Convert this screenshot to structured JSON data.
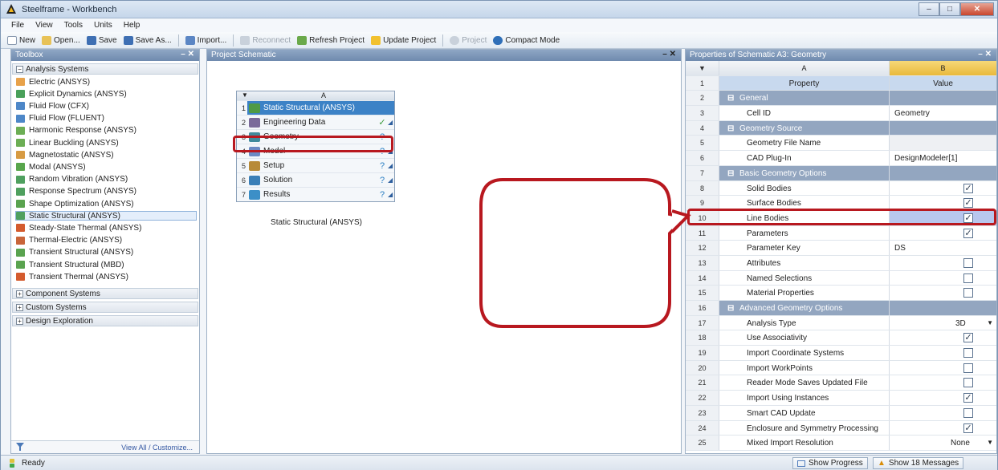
{
  "window": {
    "title": "Steelframe - Workbench"
  },
  "menu": [
    "File",
    "View",
    "Tools",
    "Units",
    "Help"
  ],
  "toolbar": {
    "new": "New",
    "open": "Open...",
    "save": "Save",
    "save_as": "Save As...",
    "import": "Import...",
    "reconnect": "Reconnect",
    "refresh": "Refresh Project",
    "update": "Update Project",
    "project": "Project",
    "compact": "Compact Mode"
  },
  "toolbox": {
    "title": "Toolbox",
    "analysis_header": "Analysis Systems",
    "items": [
      "Electric (ANSYS)",
      "Explicit Dynamics (ANSYS)",
      "Fluid Flow (CFX)",
      "Fluid Flow (FLUENT)",
      "Harmonic Response (ANSYS)",
      "Linear Buckling (ANSYS)",
      "Magnetostatic (ANSYS)",
      "Modal (ANSYS)",
      "Random Vibration (ANSYS)",
      "Response Spectrum (ANSYS)",
      "Shape Optimization (ANSYS)",
      "Static Structural (ANSYS)",
      "Steady-State Thermal (ANSYS)",
      "Thermal-Electric (ANSYS)",
      "Transient Structural (ANSYS)",
      "Transient Structural (MBD)",
      "Transient Thermal (ANSYS)"
    ],
    "component_header": "Component Systems",
    "custom_header": "Custom Systems",
    "design_header": "Design Exploration",
    "footer_link": "View All / Customize..."
  },
  "schematic": {
    "title": "Project Schematic",
    "column": "A",
    "rows": [
      {
        "n": "1",
        "label": "Static Structural (ANSYS)",
        "status": ""
      },
      {
        "n": "2",
        "label": "Engineering Data",
        "status": "✓"
      },
      {
        "n": "3",
        "label": "Geometry",
        "status": "?"
      },
      {
        "n": "4",
        "label": "Model",
        "status": "?"
      },
      {
        "n": "5",
        "label": "Setup",
        "status": "?"
      },
      {
        "n": "6",
        "label": "Solution",
        "status": "?"
      },
      {
        "n": "7",
        "label": "Results",
        "status": "?"
      }
    ],
    "caption": "Static Structural (ANSYS)"
  },
  "properties": {
    "title": "Properties of Schematic A3: Geometry",
    "col_a": "A",
    "col_b": "B",
    "rows": [
      {
        "n": "1",
        "a": "Property",
        "b": "Value",
        "type": "colh"
      },
      {
        "n": "2",
        "a": "General",
        "b": "",
        "type": "group"
      },
      {
        "n": "3",
        "a": "Cell ID",
        "b": "Geometry",
        "type": "text"
      },
      {
        "n": "4",
        "a": "Geometry Source",
        "b": "",
        "type": "group"
      },
      {
        "n": "5",
        "a": "Geometry File Name",
        "b": "",
        "type": "grey"
      },
      {
        "n": "6",
        "a": "CAD Plug-In",
        "b": "DesignModeler[1]",
        "type": "text"
      },
      {
        "n": "7",
        "a": "Basic Geometry Options",
        "b": "",
        "type": "group"
      },
      {
        "n": "8",
        "a": "Solid Bodies",
        "b": "checked",
        "type": "check"
      },
      {
        "n": "9",
        "a": "Surface Bodies",
        "b": "checked",
        "type": "check"
      },
      {
        "n": "10",
        "a": "Line Bodies",
        "b": "checked",
        "type": "check"
      },
      {
        "n": "11",
        "a": "Parameters",
        "b": "checked",
        "type": "check"
      },
      {
        "n": "12",
        "a": "Parameter Key",
        "b": "DS",
        "type": "text"
      },
      {
        "n": "13",
        "a": "Attributes",
        "b": "unchecked",
        "type": "check"
      },
      {
        "n": "14",
        "a": "Named Selections",
        "b": "unchecked",
        "type": "check"
      },
      {
        "n": "15",
        "a": "Material Properties",
        "b": "unchecked",
        "type": "check"
      },
      {
        "n": "16",
        "a": "Advanced Geometry Options",
        "b": "",
        "type": "group"
      },
      {
        "n": "17",
        "a": "Analysis Type",
        "b": "3D",
        "type": "dropdown"
      },
      {
        "n": "18",
        "a": "Use Associativity",
        "b": "checked",
        "type": "check"
      },
      {
        "n": "19",
        "a": "Import Coordinate Systems",
        "b": "unchecked",
        "type": "check"
      },
      {
        "n": "20",
        "a": "Import WorkPoints",
        "b": "unchecked",
        "type": "check"
      },
      {
        "n": "21",
        "a": "Reader Mode Saves Updated File",
        "b": "unchecked",
        "type": "check"
      },
      {
        "n": "22",
        "a": "Import Using Instances",
        "b": "checked",
        "type": "check"
      },
      {
        "n": "23",
        "a": "Smart CAD Update",
        "b": "unchecked",
        "type": "check"
      },
      {
        "n": "24",
        "a": "Enclosure and Symmetry Processing",
        "b": "checked",
        "type": "check"
      },
      {
        "n": "25",
        "a": "Mixed Import Resolution",
        "b": "None",
        "type": "dropdown"
      }
    ]
  },
  "status": {
    "text": "Ready",
    "show_progress": "Show Progress",
    "show_messages": "Show 18 Messages"
  },
  "colors": {
    "accent_red": "#b8181f",
    "selected_row": "#3c82c6",
    "panel_header": "#7c95b8"
  }
}
